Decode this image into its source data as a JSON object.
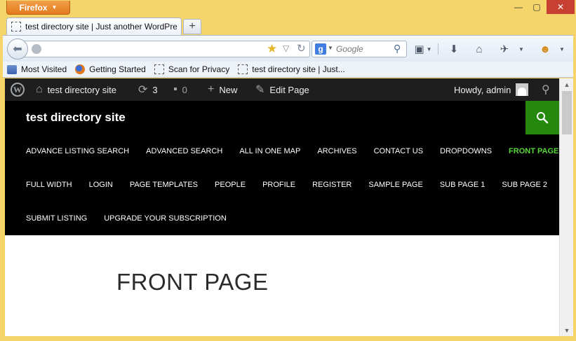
{
  "window": {
    "app_button": "Firefox",
    "minimize": "—",
    "maximize": "▢",
    "close": "✕"
  },
  "tabs": [
    {
      "title": "test directory site | Just another WordPre..."
    }
  ],
  "new_tab": "+",
  "nav": {
    "url_value": "",
    "search_placeholder": "Google",
    "search_engine": "g-icon",
    "icons": [
      "back-icon",
      "globe-icon",
      "star-icon",
      "dropdown-icon",
      "reload-icon",
      "search-icon",
      "bookmarks-icon",
      "download-icon",
      "home-icon",
      "addon-icon",
      "avatar-icon"
    ]
  },
  "bookmarks": [
    {
      "label": "Most Visited",
      "icon": "most-visited-icon"
    },
    {
      "label": "Getting Started",
      "icon": "firefox-icon"
    },
    {
      "label": "Scan for Privacy",
      "icon": "dashed-page-icon"
    },
    {
      "label": "test directory site | Just...",
      "icon": "dashed-page-icon"
    }
  ],
  "adminbar": {
    "site_name": "test directory site",
    "updates_count": "3",
    "comments_count": "0",
    "new_label": "New",
    "edit_label": "Edit Page",
    "howdy": "Howdy, admin"
  },
  "site": {
    "title": "test directory site",
    "menu_rows": [
      [
        "Advance Listing Search",
        "Advanced Search",
        "All In One Map",
        "Archives",
        "Contact Us",
        "Dropdowns",
        "Front Page"
      ],
      [
        "Full Width",
        "Login",
        "Page Templates",
        "People",
        "Profile",
        "Register",
        "Sample Page",
        "Sub Page 1",
        "Sub Page 2"
      ],
      [
        "Submit Listing",
        "Upgrade Your Subscription"
      ]
    ],
    "current_item": "Front Page",
    "accent_color": "#24890d",
    "current_color": "#55d737"
  },
  "page": {
    "title": "FRONT PAGE"
  }
}
